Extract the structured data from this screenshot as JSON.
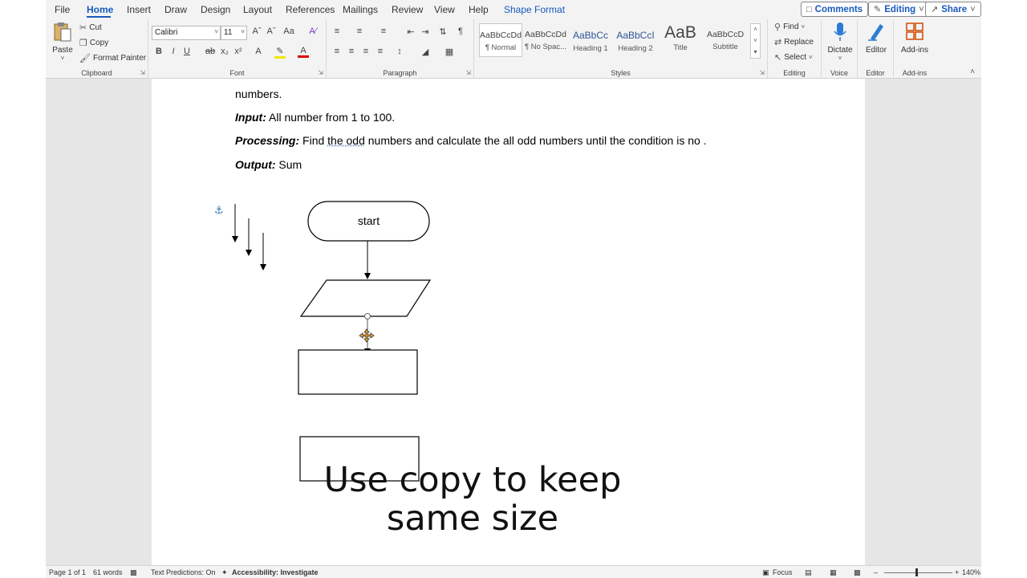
{
  "menu": {
    "items": [
      "File",
      "Home",
      "Insert",
      "Draw",
      "Design",
      "Layout",
      "References",
      "Mailings",
      "Review",
      "View",
      "Help",
      "Shape Format"
    ],
    "comments": "Comments",
    "editing": "Editing",
    "share": "Share"
  },
  "ribbon": {
    "clipboard": {
      "paste": "Paste",
      "cut": "Cut",
      "copy": "Copy",
      "format_painter": "Format Painter",
      "label": "Clipboard"
    },
    "font": {
      "name": "Calibri",
      "size": "11",
      "label": "Font"
    },
    "paragraph": {
      "label": "Paragraph"
    },
    "styles": {
      "label": "Styles",
      "items": [
        {
          "sample": "AaBbCcDd",
          "name": "¶ Normal"
        },
        {
          "sample": "AaBbCcDd",
          "name": "¶ No Spac..."
        },
        {
          "sample": "AaBbCc",
          "name": "Heading 1"
        },
        {
          "sample": "AaBbCcI",
          "name": "Heading 2"
        },
        {
          "sample": "AaB",
          "name": "Title"
        },
        {
          "sample": "AaBbCcD",
          "name": "Subtitle"
        }
      ]
    },
    "editing": {
      "find": "Find",
      "replace": "Replace",
      "select": "Select",
      "label": "Editing"
    },
    "voice": {
      "dictate": "Dictate",
      "label": "Voice"
    },
    "editor": {
      "button": "Editor",
      "label": "Editor"
    },
    "addins": {
      "button": "Add-ins",
      "label": "Add-ins"
    }
  },
  "document": {
    "line1": "numbers.",
    "input_label": "Input:",
    "input_text": "All number from 1 to 100.",
    "processing_label": "Processing:",
    "processing_pre": "Find",
    "processing_squiggle": "the  odd",
    "processing_post": "numbers and calculate the all odd numbers until the condition is no .",
    "output_label": "Output:",
    "output_text": "Sum",
    "start_label": "start",
    "caption_line1": "Use copy to  keep",
    "caption_line2": "same size"
  },
  "status": {
    "page": "Page 1 of 1",
    "words": "61 words",
    "text_predictions": "Text Predictions: On",
    "accessibility": "Accessibility: Investigate",
    "focus": "Focus",
    "zoom": "140%"
  }
}
